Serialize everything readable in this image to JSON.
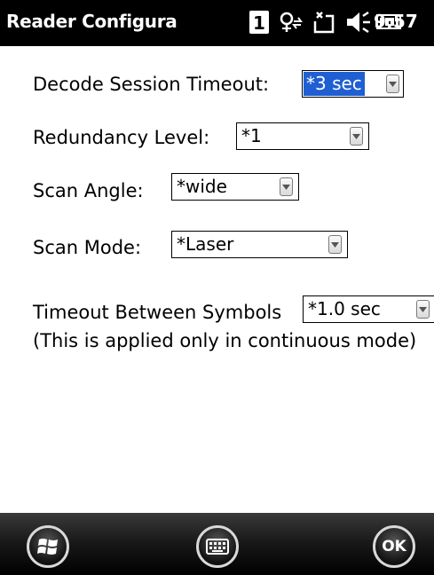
{
  "titlebar": {
    "title": "Reader Configura",
    "time": "9:57",
    "icons": [
      "sim-1-icon",
      "signal-sync-icon",
      "data-connection-icon",
      "speaker-icon",
      "battery-icon"
    ]
  },
  "form": {
    "decode_timeout": {
      "label": "Decode Session Timeout:",
      "value": "*3 sec"
    },
    "redundancy": {
      "label": "Redundancy Level:",
      "value": "*1"
    },
    "scan_angle": {
      "label": "Scan Angle:",
      "value": "*wide"
    },
    "scan_mode": {
      "label": "Scan Mode:",
      "value": "*Laser"
    },
    "timeout_between": {
      "label": "Timeout Between Symbols",
      "value": "*1.0 sec"
    },
    "note": "(This is applied only in continuous mode)"
  },
  "bottombar": {
    "ok_label": "OK",
    "icons": [
      "windows-start-icon",
      "keyboard-icon",
      "ok-icon"
    ]
  }
}
